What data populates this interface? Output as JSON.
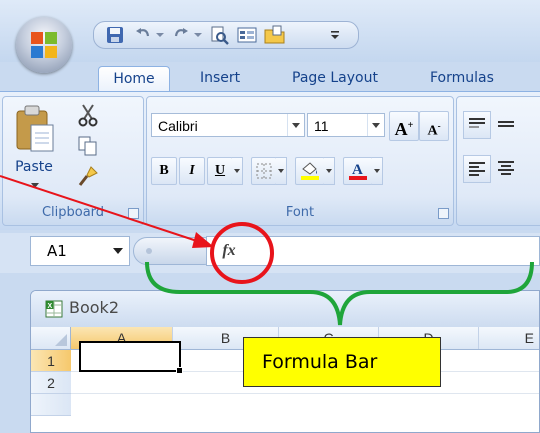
{
  "app": {
    "tabs": [
      "Home",
      "Insert",
      "Page Layout",
      "Formulas"
    ],
    "active_tab": "Home",
    "qat_icons": [
      "save-icon",
      "undo-icon",
      "redo-icon",
      "print-preview-icon",
      "form-icon",
      "open-folder-icon",
      "customize-qat-icon"
    ]
  },
  "ribbon": {
    "clipboard": {
      "label": "Clipboard",
      "paste_label": "Paste"
    },
    "font": {
      "label": "Font",
      "font_name": "Calibri",
      "font_size": "11",
      "bold": "B",
      "italic": "I",
      "underline": "U"
    }
  },
  "formula_bar": {
    "name_box": "A1",
    "fx_label": "fx",
    "value": ""
  },
  "workbook": {
    "title": "Book2",
    "columns": [
      "A",
      "B",
      "C",
      "D",
      "E"
    ],
    "rows": [
      "1",
      "2"
    ]
  },
  "annotation": {
    "label": "Formula Bar",
    "circle_color": "#e8141b",
    "brace_color": "#1fa53a",
    "box_color": "#ffff00"
  }
}
